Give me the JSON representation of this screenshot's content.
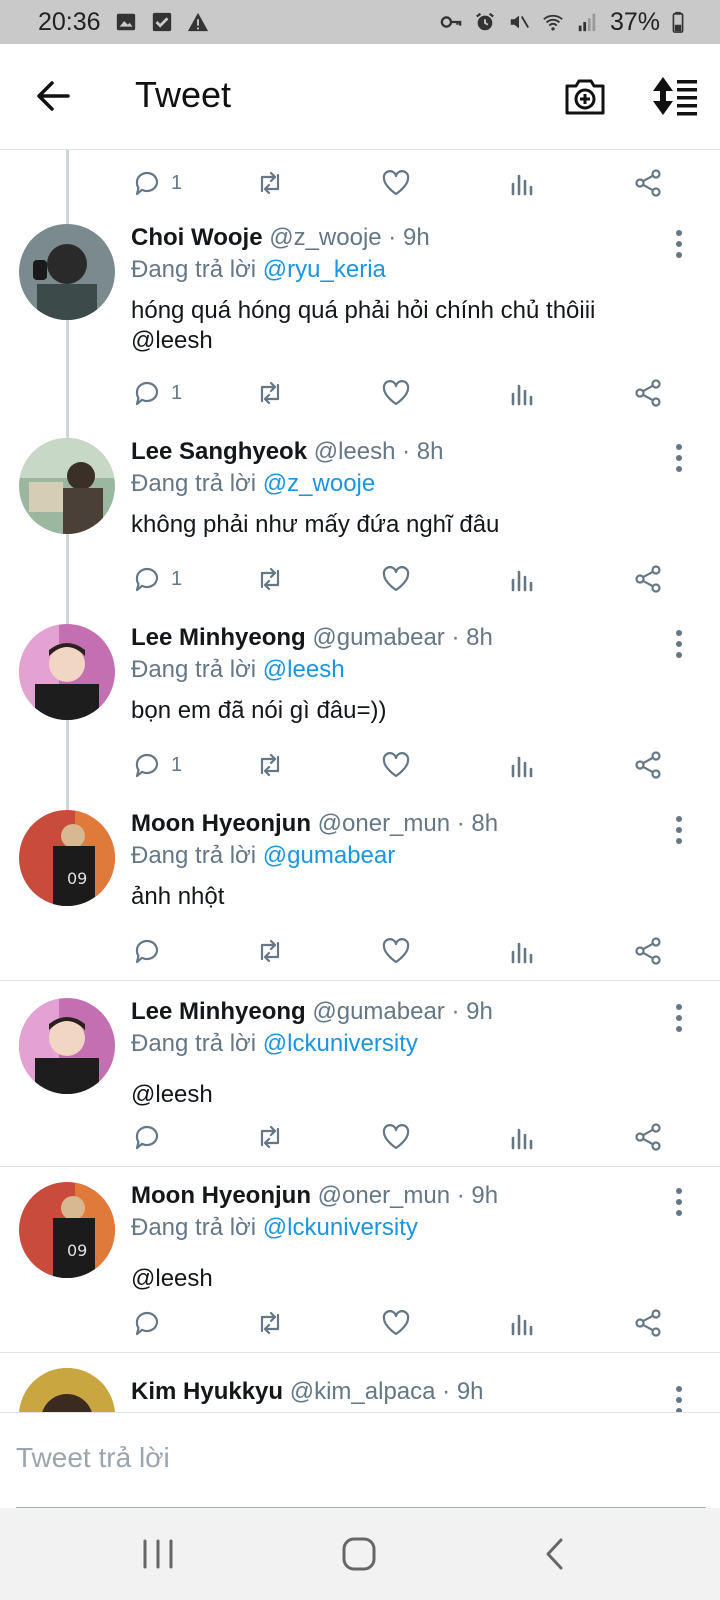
{
  "status_bar": {
    "time": "20:36",
    "battery": "37%",
    "left_icons": [
      "image-icon",
      "check-square-icon",
      "warning-icon"
    ],
    "right_icons": [
      "key-icon",
      "alarm-icon",
      "mute-icon",
      "wifi-icon",
      "signal-icon",
      "battery-icon"
    ]
  },
  "app_bar": {
    "title": "Tweet",
    "back_icon": "arrow-left-icon",
    "camera_icon": "camera-plus-icon",
    "sort_icon": "sort-icon"
  },
  "partial_top_action": {
    "reply_count": "1"
  },
  "tweets": [
    {
      "name": "Choi Wooje",
      "meta": "@z_wooje · 9h",
      "reply_prefix": "Đang trả lời ",
      "reply_to": "@ryu_keria",
      "body_text": "hóng quá hóng quá phải hỏi chính chủ thôiii",
      "body_mention": "@leesh",
      "reply_count": "1"
    },
    {
      "name": "Lee Sanghyeok",
      "meta": "@leesh · 8h",
      "reply_prefix": "Đang trả lời ",
      "reply_to": "@z_wooje",
      "body_text": "không phải như mấy đứa nghĩ đâu",
      "body_mention": "",
      "reply_count": "1"
    },
    {
      "name": "Lee Minhyeong",
      "meta": "@gumabear · 8h",
      "reply_prefix": "Đang trả lời ",
      "reply_to": "@leesh",
      "body_text": "bọn em đã nói gì đâu=))",
      "body_mention": "",
      "reply_count": "1"
    },
    {
      "name": "Moon Hyeonjun",
      "meta": "@oner_mun · 8h",
      "reply_prefix": "Đang trả lời ",
      "reply_to": "@gumabear",
      "body_text": "ảnh nhột",
      "body_mention": "",
      "reply_count": ""
    },
    {
      "name": "Lee Minhyeong",
      "meta": "@gumabear · 9h",
      "reply_prefix": "Đang trả lời ",
      "reply_to": "@lckuniversity",
      "body_text": "",
      "body_mention": "@leesh",
      "reply_count": ""
    },
    {
      "name": "Moon Hyeonjun",
      "meta": "@oner_mun · 9h",
      "reply_prefix": "Đang trả lời ",
      "reply_to": "@lckuniversity",
      "body_text": "",
      "body_mention": "@leesh",
      "reply_count": ""
    }
  ],
  "partial_bottom_tweet": {
    "name": "Kim Hyukkyu",
    "meta": "@kim_alpaca · 9h"
  },
  "reply_bar": {
    "placeholder": "Tweet trả lời"
  },
  "nav_bar": {
    "recents_icon": "recents-icon",
    "home_icon": "home-icon",
    "back_icon": "back-chevron-icon"
  },
  "colors": {
    "mention": "#1b95e0",
    "meta": "#657786",
    "status_bar_bg": "#c9c9c9",
    "thread_line": "#cfd6db"
  }
}
